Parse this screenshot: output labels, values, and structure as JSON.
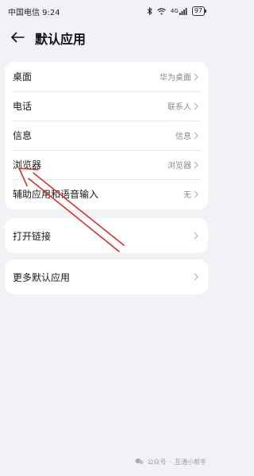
{
  "status_bar": {
    "carrier_time": "中国电信 9:24",
    "signal": "4G",
    "battery": "97"
  },
  "header": {
    "title": "默认应用",
    "back_icon": "arrow-left-icon"
  },
  "main_list": [
    {
      "label": "桌面",
      "value": "华为桌面"
    },
    {
      "label": "电话",
      "value": "联系人"
    },
    {
      "label": "信息",
      "value": "信息"
    },
    {
      "label": "浏览器",
      "value": "浏览器"
    },
    {
      "label": "辅助应用和语音输入",
      "value": "无"
    }
  ],
  "open_links": {
    "label": "打开链接"
  },
  "more_defaults": {
    "label": "更多默认应用"
  },
  "annotation": {
    "color": "#d6312b"
  },
  "watermark": {
    "source": "公众号",
    "name": "互通小帮手"
  }
}
